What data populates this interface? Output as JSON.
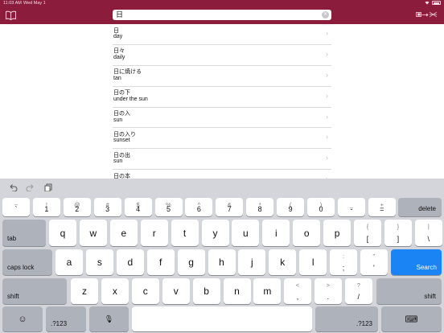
{
  "status_bar": {
    "time": "11:03 AM",
    "date": "Wed May 1"
  },
  "header": {
    "search_value": "日",
    "book_icon": "book-icon",
    "language_icon": "language-direction-icon",
    "brand_color": "#8c1c3c"
  },
  "results": [
    {
      "jp": "日",
      "en": "day"
    },
    {
      "jp": "日々",
      "en": "daily"
    },
    {
      "jp": "日に焼ける",
      "en": "tan"
    },
    {
      "jp": "日の下",
      "en": "under the sun"
    },
    {
      "jp": "日の入",
      "en": "sun"
    },
    {
      "jp": "日の入り",
      "en": "sunset"
    },
    {
      "jp": "日の出",
      "en": "sun"
    },
    {
      "jp": "日の本",
      "en": ""
    }
  ],
  "keyboard": {
    "row1": [
      {
        "top": "~",
        "bottom": "`"
      },
      {
        "top": "!",
        "bottom": "1"
      },
      {
        "top": "@",
        "bottom": "2"
      },
      {
        "top": "#",
        "bottom": "3"
      },
      {
        "top": "$",
        "bottom": "4"
      },
      {
        "top": "%",
        "bottom": "5"
      },
      {
        "top": "^",
        "bottom": "6"
      },
      {
        "top": "&",
        "bottom": "7"
      },
      {
        "top": "*",
        "bottom": "8"
      },
      {
        "top": "(",
        "bottom": "9"
      },
      {
        "top": ")",
        "bottom": "0"
      },
      {
        "top": "_",
        "bottom": "-"
      },
      {
        "top": "+",
        "bottom": "="
      }
    ],
    "delete": "delete",
    "tab": "tab",
    "row2": [
      "q",
      "w",
      "e",
      "r",
      "t",
      "y",
      "u",
      "i",
      "o",
      "p"
    ],
    "row2_extra": [
      {
        "top": "{",
        "bottom": "["
      },
      {
        "top": "}",
        "bottom": "]"
      },
      {
        "top": "|",
        "bottom": "\\"
      }
    ],
    "caps_lock": "caps lock",
    "row3": [
      "a",
      "s",
      "d",
      "f",
      "g",
      "h",
      "j",
      "k",
      "l"
    ],
    "row3_extra": [
      {
        "top": ":",
        "bottom": ";"
      },
      {
        "top": "\"",
        "bottom": "'"
      }
    ],
    "search": "Search",
    "shift": "shift",
    "row4": [
      "z",
      "x",
      "c",
      "v",
      "b",
      "n",
      "m"
    ],
    "row4_extra": [
      {
        "top": "<",
        "bottom": ","
      },
      {
        "top": ">",
        "bottom": "."
      },
      {
        "top": "?",
        "bottom": "/"
      }
    ],
    "numbers": ".?123"
  }
}
